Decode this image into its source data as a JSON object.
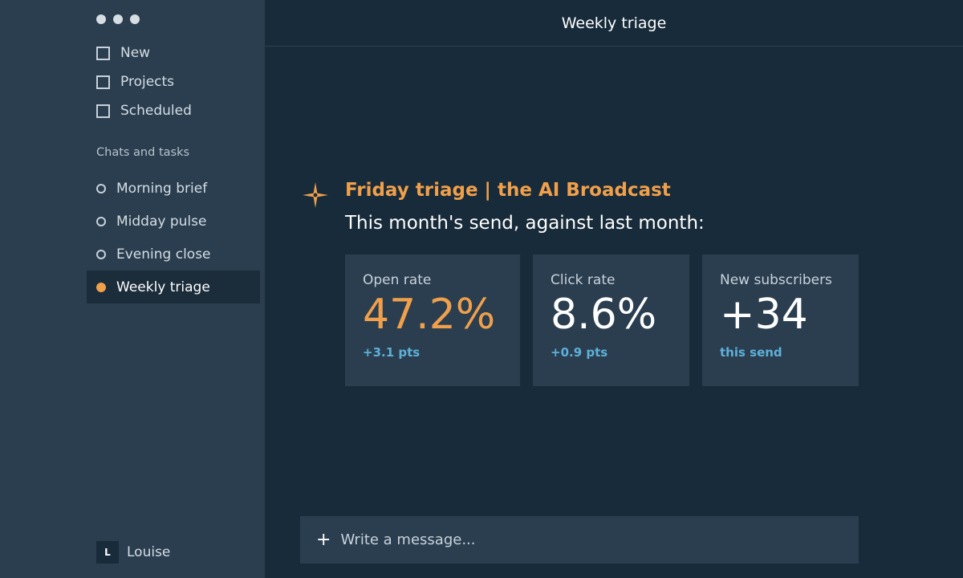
{
  "window": {
    "controls": [
      "dot",
      "dot",
      "dot"
    ]
  },
  "sidebar": {
    "nav": [
      {
        "label": "New",
        "icon": "checkbox-icon"
      },
      {
        "label": "Projects",
        "icon": "checkbox-icon"
      },
      {
        "label": "Scheduled",
        "icon": "checkbox-icon"
      }
    ],
    "section_label": "Chats and tasks",
    "chats": [
      {
        "label": "Morning brief",
        "active": false
      },
      {
        "label": "Midday pulse",
        "active": false
      },
      {
        "label": "Evening close",
        "active": false
      },
      {
        "label": "Weekly triage",
        "active": true
      }
    ],
    "user": {
      "initial": "L",
      "name": "Louise"
    }
  },
  "header": {
    "title": "Weekly triage"
  },
  "message": {
    "icon": "sparkle-icon",
    "title": "Friday triage | the AI Broadcast",
    "subtitle": "This month's send, against last month:"
  },
  "stats": [
    {
      "label": "Open rate",
      "value": "47.2%",
      "delta": "+3.1 pts"
    },
    {
      "label": "Click rate",
      "value": "8.6%",
      "delta": "+0.9 pts"
    },
    {
      "label": "New subscribers",
      "value": "+34",
      "delta": "this send"
    }
  ],
  "composer": {
    "icon": "plus-icon",
    "placeholder": "Write a message..."
  },
  "colors": {
    "accent": "#f0a04b",
    "delta": "#5fb0d8",
    "sidebar_bg": "#2a3e50",
    "main_bg": "#182b3a"
  }
}
